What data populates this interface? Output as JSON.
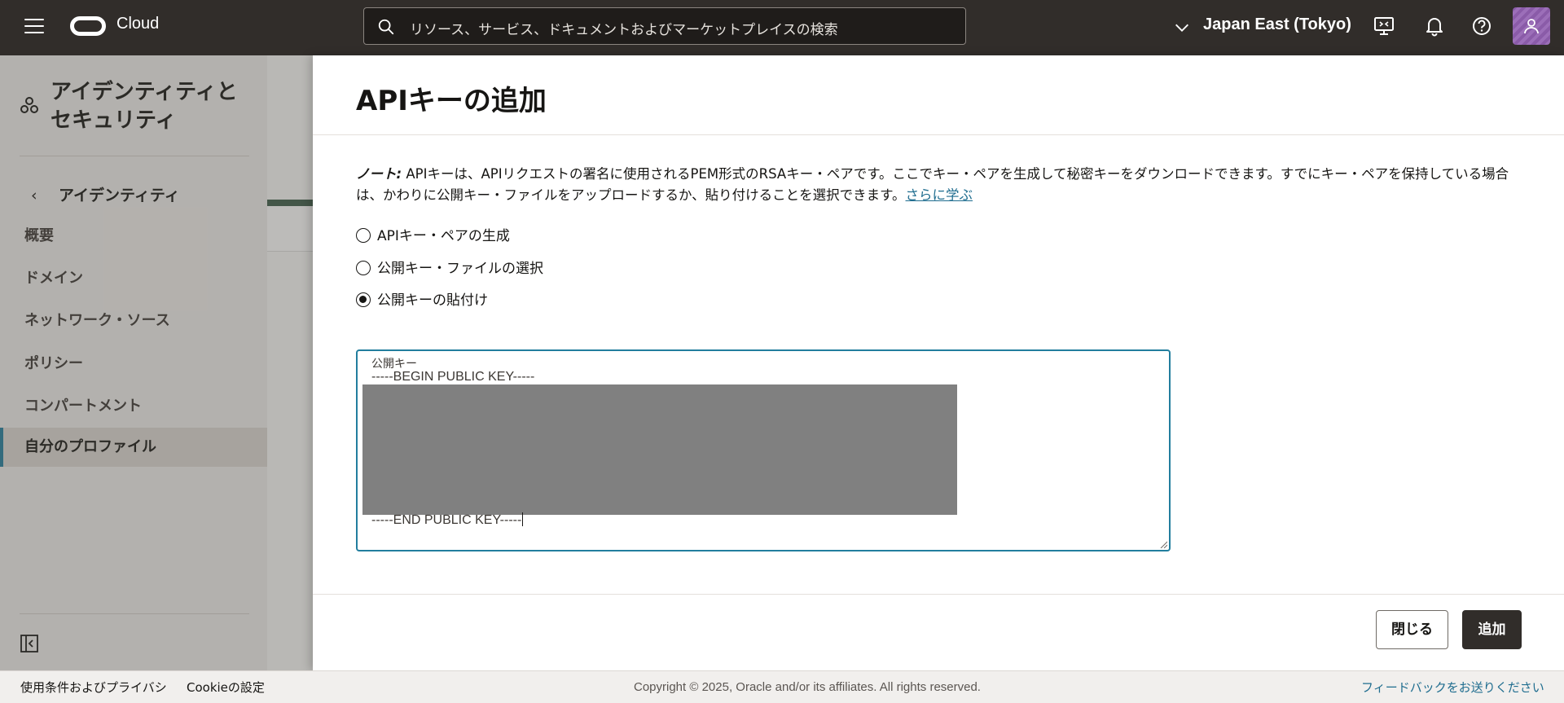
{
  "topbar": {
    "brand": "Cloud",
    "search_placeholder": "リソース、サービス、ドキュメントおよびマーケットプレイスの検索",
    "region": "Japan East (Tokyo)"
  },
  "leftnav": {
    "title": "アイデンティティとセキュリティ",
    "back_label": "アイデンティティ",
    "items": [
      {
        "label": "概要"
      },
      {
        "label": "ドメイン"
      },
      {
        "label": "ネットワーク・ソース"
      },
      {
        "label": "ポリシー"
      },
      {
        "label": "コンパートメント"
      },
      {
        "label": "自分のプロファイル",
        "active": true
      }
    ]
  },
  "drawer": {
    "title": "APIキーの追加",
    "note_label": "ノート:",
    "note_text": " APIキーは、APIリクエストの署名に使用されるPEM形式のRSAキー・ペアです。ここでキー・ペアを生成して秘密キーをダウンロードできます。すでにキー・ペアを保持している場合は、かわりに公開キー・ファイルをアップロードするか、貼り付けることを選択できます。",
    "learn_more": "さらに学ぶ",
    "options": [
      {
        "label": "APIキー・ペアの生成",
        "checked": false
      },
      {
        "label": "公開キー・ファイルの選択",
        "checked": false
      },
      {
        "label": "公開キーの貼付け",
        "checked": true
      }
    ],
    "key_field": {
      "label": "公開キー",
      "first_line": "-----BEGIN PUBLIC KEY-----",
      "last_line": "-----END PUBLIC KEY-----"
    },
    "close_label": "閉じる",
    "add_label": "追加"
  },
  "footer": {
    "terms": "使用条件およびプライバシ",
    "cookie": "Cookieの設定",
    "copyright": "Copyright © 2025, Oracle and/or its affiliates. All rights reserved.",
    "feedback": "フィードバックをお送りください"
  },
  "colors": {
    "topbar_bg": "#312d2a",
    "accent": "#227e9e",
    "link": "#1f6d8f",
    "primary_button": "#312d2a"
  }
}
